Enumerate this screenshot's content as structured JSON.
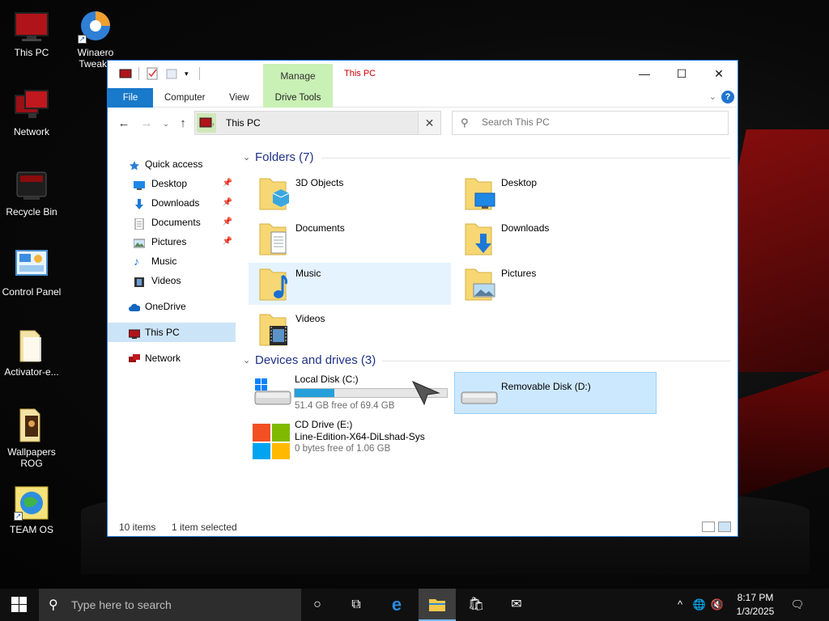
{
  "desktop": {
    "icons": [
      {
        "label": "This PC",
        "icon": "this-pc-icon"
      },
      {
        "label": "Winaero Tweake",
        "icon": "winaero-tweaker-icon"
      },
      {
        "label": "Network",
        "icon": "network-icon"
      },
      {
        "label": "Recycle Bin",
        "icon": "recycle-bin-icon"
      },
      {
        "label": "Control Panel",
        "icon": "control-panel-icon"
      },
      {
        "label": "Activator-e...",
        "icon": "folder-icon"
      },
      {
        "label": "Wallpapers ROG",
        "icon": "wallpapers-icon"
      },
      {
        "label": "TEAM OS",
        "icon": "team-os-icon"
      }
    ]
  },
  "window": {
    "title": "This PC",
    "manage_tab": "Manage",
    "ribbon_tabs": [
      "File",
      "Computer",
      "View",
      "Drive Tools"
    ],
    "address": {
      "crumb": "This PC"
    },
    "search": {
      "placeholder": "Search This PC"
    },
    "nav_pane": [
      {
        "label": "Quick access",
        "icon": "star-icon",
        "pinned": false,
        "level": 0
      },
      {
        "label": "Desktop",
        "icon": "desktop-icon",
        "pinned": true,
        "level": 1
      },
      {
        "label": "Downloads",
        "icon": "download-icon",
        "pinned": true,
        "level": 1
      },
      {
        "label": "Documents",
        "icon": "document-icon",
        "pinned": true,
        "level": 1
      },
      {
        "label": "Pictures",
        "icon": "picture-icon",
        "pinned": true,
        "level": 1
      },
      {
        "label": "Music",
        "icon": "music-icon",
        "pinned": false,
        "level": 1
      },
      {
        "label": "Videos",
        "icon": "video-icon",
        "pinned": false,
        "level": 1
      },
      {
        "label": "OneDrive",
        "icon": "cloud-icon",
        "pinned": false,
        "level": 0
      },
      {
        "label": "This PC",
        "icon": "pc-icon",
        "pinned": false,
        "level": 0,
        "selected": true
      },
      {
        "label": "Network",
        "icon": "network-icon",
        "pinned": false,
        "level": 0
      }
    ],
    "folders_header": "Folders (7)",
    "folders": [
      {
        "name": "3D Objects",
        "icon": "3d-objects-icon"
      },
      {
        "name": "Desktop",
        "icon": "desktop-icon"
      },
      {
        "name": "Documents",
        "icon": "documents-icon"
      },
      {
        "name": "Downloads",
        "icon": "downloads-icon"
      },
      {
        "name": "Music",
        "icon": "music-icon",
        "hover": true
      },
      {
        "name": "Pictures",
        "icon": "pictures-icon"
      },
      {
        "name": "Videos",
        "icon": "videos-icon"
      }
    ],
    "drives_header": "Devices and drives (3)",
    "drives": {
      "c": {
        "name": "Local Disk (C:)",
        "free": "51.4 GB free of 69.4 GB",
        "used_fraction": 0.26
      },
      "d": {
        "name": "Removable Disk (D:)",
        "selected": true
      },
      "e": {
        "name": "CD Drive (E:)",
        "label": "Line-Edition-X64-DiLshad-Sys",
        "free": "0 bytes free of 1.06 GB"
      }
    },
    "status": {
      "items": "10 items",
      "selected": "1 item selected"
    }
  },
  "taskbar": {
    "search_placeholder": "Type here to search",
    "time": "8:17 PM",
    "date": "1/3/2025"
  },
  "colors": {
    "accent": "#1979ca",
    "manage": "#c9f0b5",
    "title": "#cc0000",
    "header": "#1e3287"
  }
}
